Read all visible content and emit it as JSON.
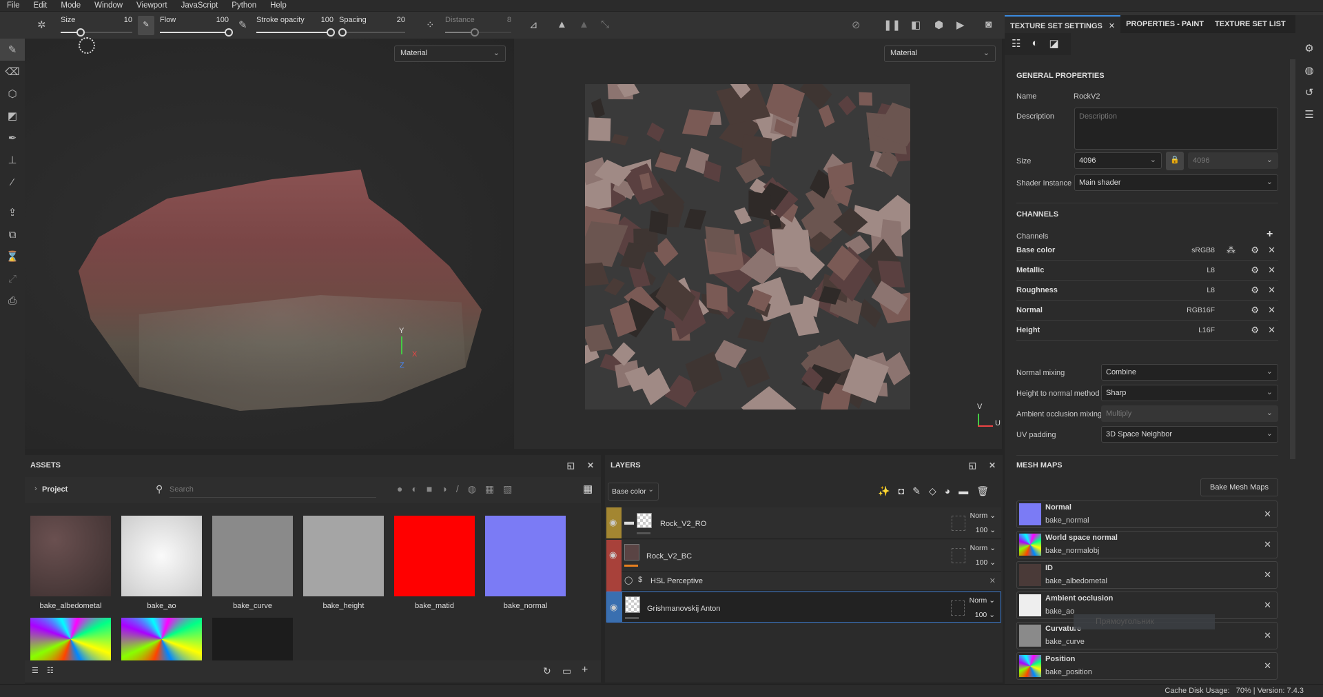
{
  "menu": [
    "File",
    "Edit",
    "Mode",
    "Window",
    "Viewport",
    "JavaScript",
    "Python",
    "Help"
  ],
  "toolbar": {
    "size_label": "Size",
    "size": "10",
    "size_frac": 0.28,
    "flow_label": "Flow",
    "flow": "100",
    "stroke_opacity_label": "Stroke opacity",
    "stroke_opacity": "100",
    "spacing_label": "Spacing",
    "spacing": "20",
    "spacing_frac": 0.05,
    "distance_label": "Distance",
    "distance": "8",
    "distance_frac": 0.45
  },
  "viewport3d": {
    "mode": "Material",
    "axis_y": "Y",
    "axis_x": "X",
    "axis_z": "Z"
  },
  "viewport2d": {
    "mode": "Material",
    "axis_v": "V",
    "axis_u": "U"
  },
  "assets": {
    "title": "ASSETS",
    "breadcrumb": "Project",
    "search_placeholder": "Search",
    "items": [
      {
        "name": "bake_albedometal"
      },
      {
        "name": "bake_ao"
      },
      {
        "name": "bake_curve"
      },
      {
        "name": "bake_height"
      },
      {
        "name": "bake_matid"
      },
      {
        "name": "bake_normal"
      }
    ]
  },
  "layers": {
    "title": "LAYERS",
    "channel": "Base color",
    "items": [
      {
        "name": "Rock_V2_RO",
        "blend": "Norm",
        "opacity": "100",
        "color": "#a38631"
      },
      {
        "name": "Rock_V2_BC",
        "blend": "Norm",
        "opacity": "100",
        "color": "#a8413a"
      },
      {
        "name": "Grishmanovskij Anton",
        "blend": "Norm",
        "opacity": "100",
        "color": "#3a6fb0"
      }
    ],
    "effect": {
      "name": "HSL Perceptive"
    }
  },
  "right": {
    "tabs": [
      "TEXTURE SET SETTINGS",
      "PROPERTIES - PAINT",
      "TEXTURE SET LIST"
    ],
    "general_title": "GENERAL PROPERTIES",
    "name_label": "Name",
    "name": "RockV2",
    "description_label": "Description",
    "description_placeholder": "Description",
    "size_label": "Size",
    "size": "4096",
    "size2": "4096",
    "shader_label": "Shader Instance",
    "shader": "Main shader",
    "channels_title": "CHANNELS",
    "channels_label": "Channels",
    "channels": [
      {
        "name": "Base color",
        "format": "sRGB8"
      },
      {
        "name": "Metallic",
        "format": "L8"
      },
      {
        "name": "Roughness",
        "format": "L8"
      },
      {
        "name": "Normal",
        "format": "RGB16F"
      },
      {
        "name": "Height",
        "format": "L16F"
      }
    ],
    "normal_mixing_label": "Normal mixing",
    "normal_mixing": "Combine",
    "h2n_label": "Height to normal method",
    "h2n": "Sharp",
    "ao_mixing_label": "Ambient occlusion mixing",
    "ao_mixing": "Multiply",
    "uv_padding_label": "UV padding",
    "uv_padding": "3D Space Neighbor",
    "mesh_title": "MESH MAPS",
    "bake_button": "Bake Mesh Maps",
    "mesh_maps": [
      {
        "title": "Normal",
        "file": "bake_normal"
      },
      {
        "title": "World space normal",
        "file": "bake_normalobj"
      },
      {
        "title": "ID",
        "file": "bake_albedometal"
      },
      {
        "title": "Ambient occlusion",
        "file": "bake_ao"
      },
      {
        "title": "Curvature",
        "file": "bake_curve"
      },
      {
        "title": "Position",
        "file": "bake_position"
      }
    ],
    "tooltip": "Прямоугольник"
  },
  "status": {
    "cache_label": "Cache Disk Usage:",
    "cache": "70%",
    "version_label": "Version:",
    "version": "7.4.3"
  }
}
